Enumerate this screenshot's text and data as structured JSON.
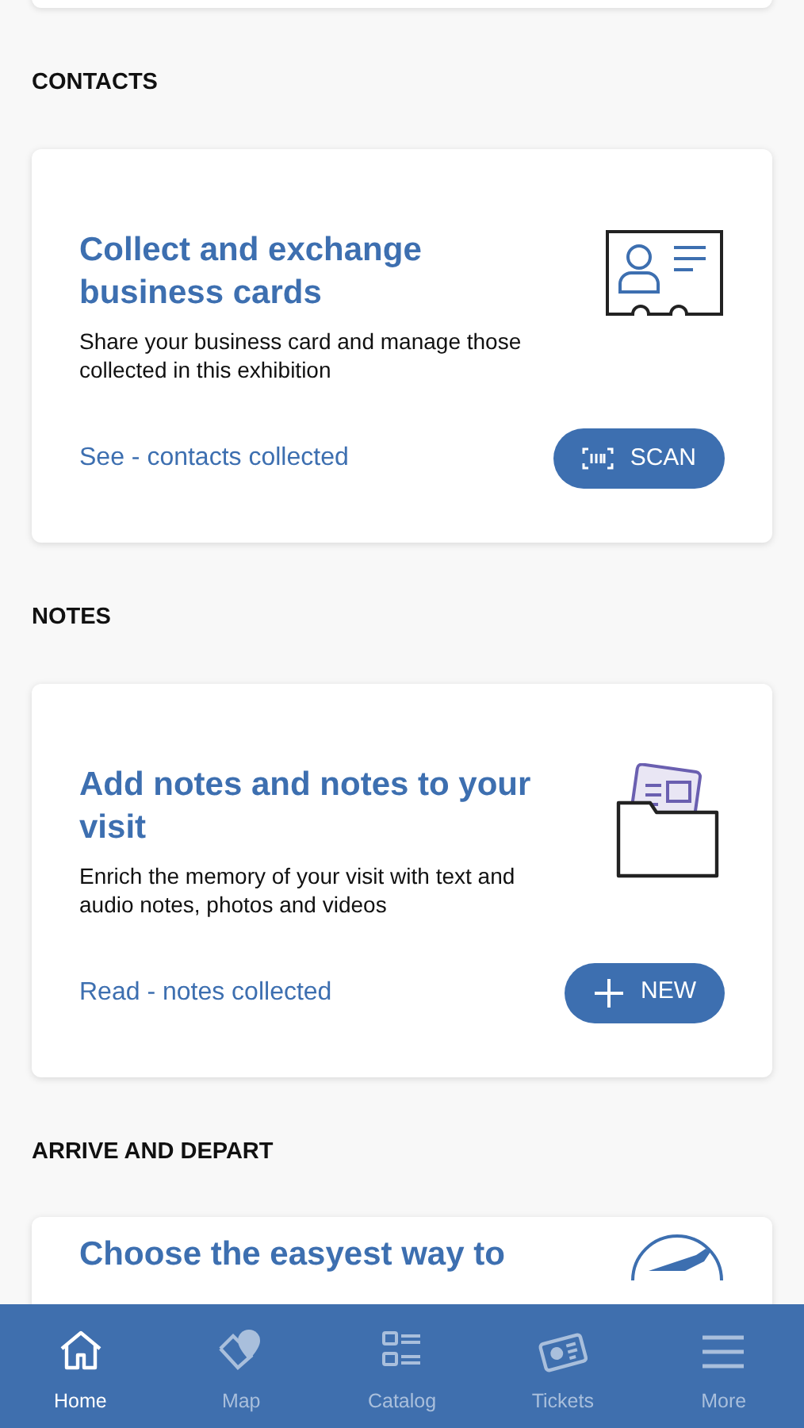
{
  "sections": [
    {
      "heading": "CONTACTS",
      "card": {
        "kind": "contacts",
        "title": "Collect and exchange business cards",
        "description": "Share your business card and manage those collected in this exhibition",
        "link": "See - contacts collected",
        "button": {
          "kind": "scan",
          "label": "SCAN"
        }
      }
    },
    {
      "heading": "NOTES",
      "card": {
        "kind": "notes",
        "title": "Add notes and notes to your visit",
        "description": "Enrich the memory of your visit with text and audio notes, photos and videos",
        "link": "Read - notes collected",
        "button": {
          "kind": "new",
          "label": "NEW"
        }
      }
    },
    {
      "heading": "ARRIVE AND DEPART",
      "card": {
        "kind": "travel",
        "title": "Choose the easyest way to"
      }
    }
  ],
  "tab_bar": [
    {
      "kind": "home",
      "label": "Home",
      "selected": true
    },
    {
      "kind": "map",
      "label": "Map",
      "selected": false
    },
    {
      "kind": "catalog",
      "label": "Catalog",
      "selected": false
    },
    {
      "kind": "tickets",
      "label": "Tickets",
      "selected": false
    },
    {
      "kind": "more",
      "label": "More",
      "selected": false
    }
  ]
}
